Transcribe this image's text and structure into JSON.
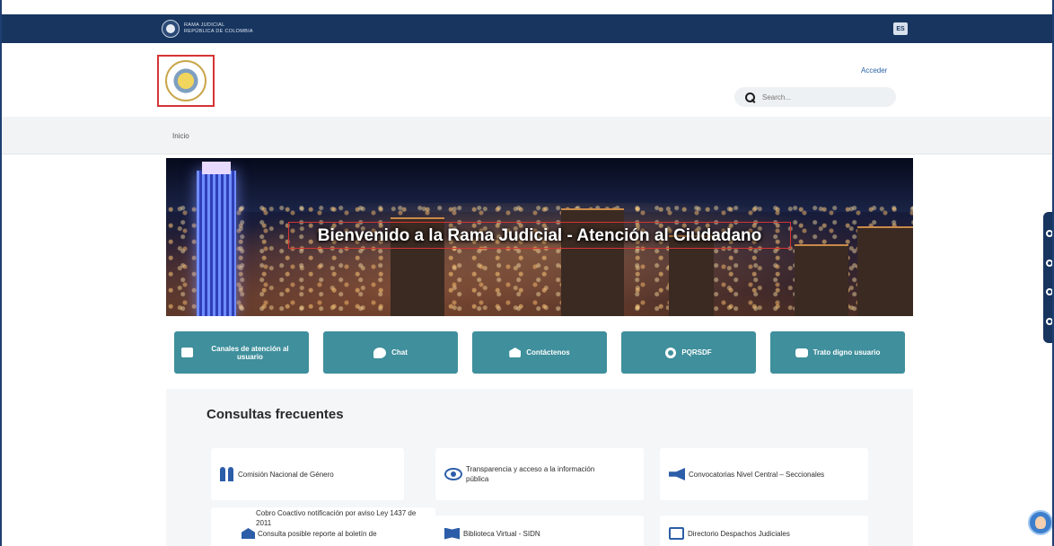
{
  "topbar": {
    "org_line1": "RAMA JUDICIAL",
    "org_line2": "REPÚBLICA DE COLOMBIA",
    "language": "ES"
  },
  "header": {
    "login_label": "Acceder",
    "search_placeholder": "Search..."
  },
  "breadcrumb": {
    "home": "Inicio"
  },
  "hero": {
    "title": "Bienvenido a la Rama Judicial - Atención al Ciudadano"
  },
  "quick_buttons": [
    {
      "label": "Canales de atención al usuario",
      "icon": "monitor-icon"
    },
    {
      "label": "Chat",
      "icon": "chat-icon"
    },
    {
      "label": "Contáctenos",
      "icon": "envelope-icon"
    },
    {
      "label": "PQRSDF",
      "icon": "paperclip-icon"
    },
    {
      "label": "Trato digno usuario",
      "icon": "handshake-icon"
    }
  ],
  "consultas": {
    "title": "Consultas frecuentes",
    "cards": [
      {
        "label": "Comisión Nacional de Género",
        "icon": "people-icon"
      },
      {
        "label": "Transparencia y acceso a la información pública",
        "icon": "eye-icon"
      },
      {
        "label": "Convocatorias Nivel Central – Seccionales",
        "icon": "megaphone-icon"
      },
      {
        "label": "Cobro Coactivo notificación por aviso Ley 1437 de 2011",
        "label2": "Consulta posible reporte al boletín de",
        "icon": "envelope-icon"
      },
      {
        "label": "Biblioteca Virtual - SIDN",
        "icon": "book-icon"
      },
      {
        "label": "Directorio Despachos Judiciales",
        "icon": "folder-icon"
      }
    ]
  },
  "colors": {
    "navy": "#17355f",
    "teal_button": "#3f8f9c",
    "icon_blue": "#2c5da8",
    "highlight_red": "#d63434"
  }
}
